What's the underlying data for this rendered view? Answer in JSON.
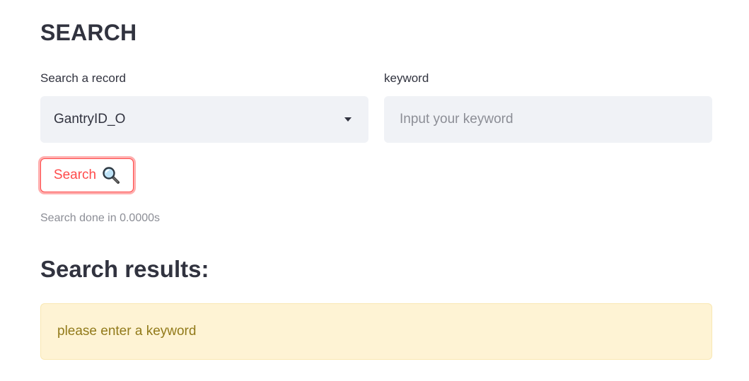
{
  "page": {
    "title": "SEARCH"
  },
  "search_form": {
    "record_label": "Search a record",
    "record_select": {
      "selected_value": "GantryID_O",
      "icon": "chevron-down-icon"
    },
    "keyword_label": "keyword",
    "keyword_input": {
      "value": "",
      "placeholder": "Input your keyword"
    },
    "search_button": {
      "label": "Search",
      "icon": "magnifier-icon"
    }
  },
  "status": {
    "text": "Search done in 0.0000s"
  },
  "results": {
    "heading": "Search results:",
    "warning_message": "please enter a keyword"
  },
  "colors": {
    "text_primary": "#31333f",
    "text_muted": "#8c8e96",
    "input_background": "#f0f2f6",
    "accent": "#ff4b4b",
    "warning_background": "#fef3d4",
    "warning_text": "#927a1a"
  }
}
